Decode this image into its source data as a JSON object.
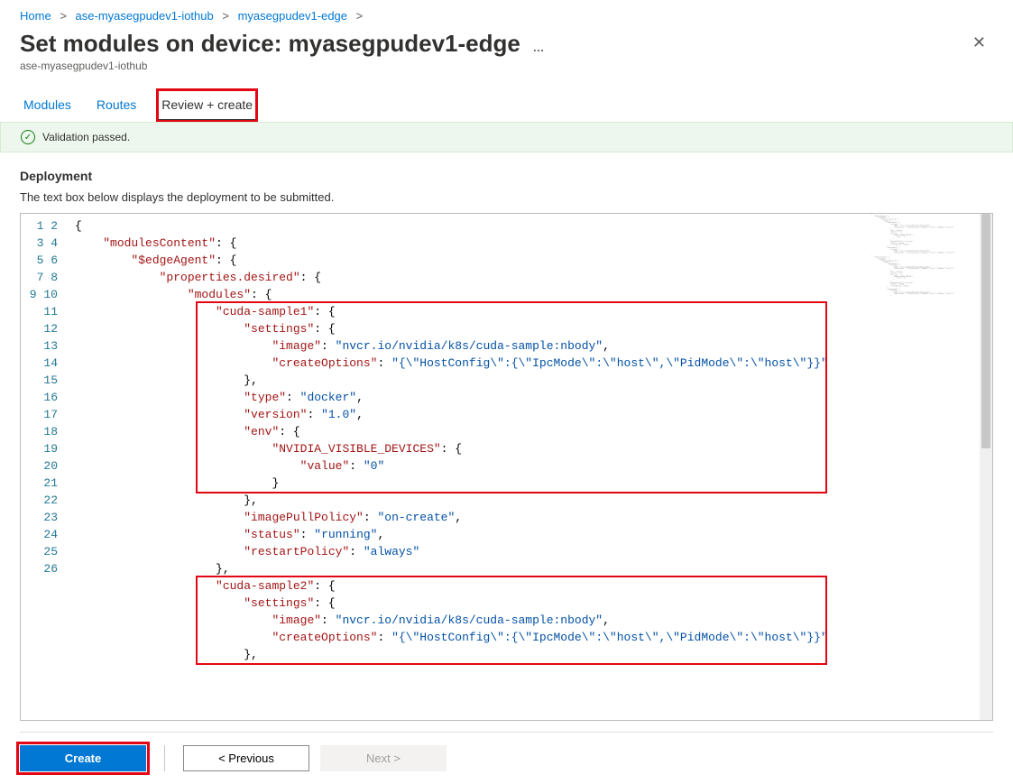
{
  "breadcrumb": {
    "items": [
      "Home",
      "ase-myasegpudev1-iothub",
      "myasegpudev1-edge"
    ]
  },
  "header": {
    "title": "Set modules on device: myasegpudev1-edge",
    "subtitle": "ase-myasegpudev1-iothub"
  },
  "tabs": {
    "items": [
      "Modules",
      "Routes",
      "Review + create"
    ],
    "active_index": 2
  },
  "validation": {
    "message": "Validation passed."
  },
  "deployment": {
    "section_title": "Deployment",
    "description": "The text box below displays the deployment to be submitted."
  },
  "footer": {
    "create": "Create",
    "previous": "< Previous",
    "next": "Next >"
  },
  "code": {
    "lines": [
      [
        [
          "pun",
          "{"
        ]
      ],
      [
        [
          "ind",
          1
        ],
        [
          "key",
          "\"modulesContent\""
        ],
        [
          "pun",
          ": {"
        ]
      ],
      [
        [
          "ind",
          2
        ],
        [
          "key",
          "\"$edgeAgent\""
        ],
        [
          "pun",
          ": {"
        ]
      ],
      [
        [
          "ind",
          3
        ],
        [
          "key",
          "\"properties.desired\""
        ],
        [
          "pun",
          ": {"
        ]
      ],
      [
        [
          "ind",
          4
        ],
        [
          "key",
          "\"modules\""
        ],
        [
          "pun",
          ": {"
        ]
      ],
      [
        [
          "ind",
          5
        ],
        [
          "key",
          "\"cuda-sample1\""
        ],
        [
          "pun",
          ": {"
        ]
      ],
      [
        [
          "ind",
          6
        ],
        [
          "key",
          "\"settings\""
        ],
        [
          "pun",
          ": {"
        ]
      ],
      [
        [
          "ind",
          7
        ],
        [
          "key",
          "\"image\""
        ],
        [
          "pun",
          ": "
        ],
        [
          "str",
          "\"nvcr.io/nvidia/k8s/cuda-sample:nbody\""
        ],
        [
          "pun",
          ","
        ]
      ],
      [
        [
          "ind",
          7
        ],
        [
          "key",
          "\"createOptions\""
        ],
        [
          "pun",
          ": "
        ],
        [
          "str",
          "\"{\\\"HostConfig\\\":{\\\"IpcMode\\\":\\\"host\\\",\\\"PidMode\\\":\\\"host\\\"}}\""
        ]
      ],
      [
        [
          "ind",
          6
        ],
        [
          "pun",
          "},"
        ]
      ],
      [
        [
          "ind",
          6
        ],
        [
          "key",
          "\"type\""
        ],
        [
          "pun",
          ": "
        ],
        [
          "str",
          "\"docker\""
        ],
        [
          "pun",
          ","
        ]
      ],
      [
        [
          "ind",
          6
        ],
        [
          "key",
          "\"version\""
        ],
        [
          "pun",
          ": "
        ],
        [
          "str",
          "\"1.0\""
        ],
        [
          "pun",
          ","
        ]
      ],
      [
        [
          "ind",
          6
        ],
        [
          "key",
          "\"env\""
        ],
        [
          "pun",
          ": {"
        ]
      ],
      [
        [
          "ind",
          7
        ],
        [
          "key",
          "\"NVIDIA_VISIBLE_DEVICES\""
        ],
        [
          "pun",
          ": {"
        ]
      ],
      [
        [
          "ind",
          8
        ],
        [
          "key",
          "\"value\""
        ],
        [
          "pun",
          ": "
        ],
        [
          "str",
          "\"0\""
        ]
      ],
      [
        [
          "ind",
          7
        ],
        [
          "pun",
          "}"
        ]
      ],
      [
        [
          "ind",
          6
        ],
        [
          "pun",
          "},"
        ]
      ],
      [
        [
          "ind",
          6
        ],
        [
          "key",
          "\"imagePullPolicy\""
        ],
        [
          "pun",
          ": "
        ],
        [
          "str",
          "\"on-create\""
        ],
        [
          "pun",
          ","
        ]
      ],
      [
        [
          "ind",
          6
        ],
        [
          "key",
          "\"status\""
        ],
        [
          "pun",
          ": "
        ],
        [
          "str",
          "\"running\""
        ],
        [
          "pun",
          ","
        ]
      ],
      [
        [
          "ind",
          6
        ],
        [
          "key",
          "\"restartPolicy\""
        ],
        [
          "pun",
          ": "
        ],
        [
          "str",
          "\"always\""
        ]
      ],
      [
        [
          "ind",
          5
        ],
        [
          "pun",
          "},"
        ]
      ],
      [
        [
          "ind",
          5
        ],
        [
          "key",
          "\"cuda-sample2\""
        ],
        [
          "pun",
          ": {"
        ]
      ],
      [
        [
          "ind",
          6
        ],
        [
          "key",
          "\"settings\""
        ],
        [
          "pun",
          ": {"
        ]
      ],
      [
        [
          "ind",
          7
        ],
        [
          "key",
          "\"image\""
        ],
        [
          "pun",
          ": "
        ],
        [
          "str",
          "\"nvcr.io/nvidia/k8s/cuda-sample:nbody\""
        ],
        [
          "pun",
          ","
        ]
      ],
      [
        [
          "ind",
          7
        ],
        [
          "key",
          "\"createOptions\""
        ],
        [
          "pun",
          ": "
        ],
        [
          "str",
          "\"{\\\"HostConfig\\\":{\\\"IpcMode\\\":\\\"host\\\",\\\"PidMode\\\":\\\"host\\\"}}\""
        ]
      ],
      [
        [
          "ind",
          6
        ],
        [
          "pun",
          "},"
        ]
      ]
    ]
  }
}
